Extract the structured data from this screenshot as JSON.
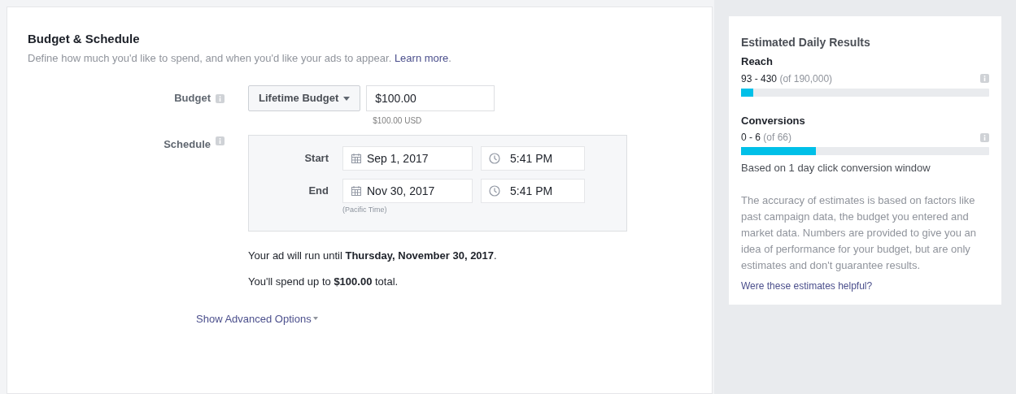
{
  "section": {
    "title": "Budget & Schedule",
    "description": "Define how much you'd like to spend, and when you'd like your ads to appear.",
    "learn_more": "Learn more",
    "learn_more_after": "."
  },
  "budget": {
    "label": "Budget",
    "type_dropdown": "Lifetime Budget",
    "amount": "$100.00",
    "amount_note": "$100.00 USD"
  },
  "schedule": {
    "label": "Schedule",
    "rows": [
      {
        "label": "Start",
        "date": "Sep 1, 2017",
        "time": "5:41 PM"
      },
      {
        "label": "End",
        "date": "Nov 30, 2017",
        "time": "5:41 PM"
      }
    ],
    "timezone_note": "(Pacific Time)"
  },
  "summary": [
    "Your ad will run until **Thursday, November 30, 2017**.",
    "You'll spend up to **$100.00** total."
  ],
  "advanced_link": "Show Advanced Options",
  "estimates": {
    "title": "Estimated Daily Results",
    "metrics": [
      {
        "name": "Reach",
        "range": "93 - 430",
        "total": "(of 190,000)",
        "level": 0.05
      },
      {
        "name": "Conversions",
        "range": "0 - 6",
        "total": "(of 66)",
        "level": 0.3
      }
    ],
    "window_note": "Based on 1 day click conversion window",
    "disclaimer": "The accuracy of estimates is based on factors like past campaign data, the budget you entered and market data. Numbers are provided to give you an idea of performance for your budget, but are only estimates and don't guarantee results.",
    "feedback_link": "Were these estimates helpful?"
  }
}
